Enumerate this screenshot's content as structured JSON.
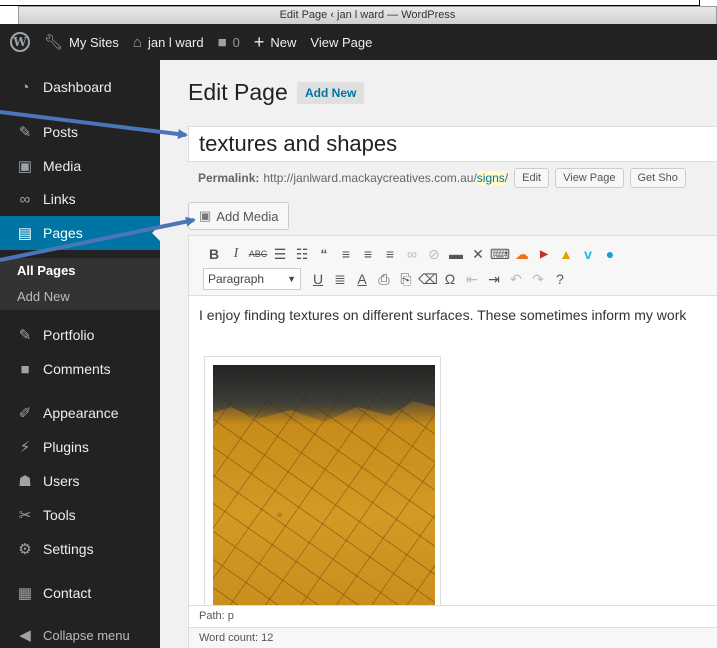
{
  "window": {
    "title": "Edit Page ‹ jan l ward — WordPress"
  },
  "adminbar": {
    "my_sites": "My Sites",
    "site_name": "jan l ward",
    "comments_count": "0",
    "new_label": "New",
    "view_page": "View Page",
    "icons": [
      "wordpress-logo",
      "wrench",
      "home",
      "comment-bubble",
      "plus"
    ]
  },
  "sidebar": {
    "items": [
      {
        "label": "Dashboard",
        "icon": "dashboard-icon"
      },
      {
        "label": "Posts",
        "icon": "pin-icon"
      },
      {
        "label": "Media",
        "icon": "media-icon"
      },
      {
        "label": "Links",
        "icon": "link-icon"
      },
      {
        "label": "Pages",
        "icon": "pages-icon",
        "active": true
      },
      {
        "label": "Portfolio",
        "icon": "pin-icon"
      },
      {
        "label": "Comments",
        "icon": "comment-icon"
      },
      {
        "label": "Appearance",
        "icon": "brush-icon"
      },
      {
        "label": "Plugins",
        "icon": "plug-icon"
      },
      {
        "label": "Users",
        "icon": "user-icon"
      },
      {
        "label": "Tools",
        "icon": "wrench-icon"
      },
      {
        "label": "Settings",
        "icon": "settings-icon"
      },
      {
        "label": "Contact",
        "icon": "form-icon"
      },
      {
        "label": "Collapse menu",
        "icon": "collapse-icon"
      }
    ],
    "pages_sub": [
      "All Pages",
      "Add New"
    ]
  },
  "main": {
    "heading": "Edit Page",
    "add_new": "Add New",
    "title_value": "textures and shapes",
    "permalink_label": "Permalink:",
    "permalink_base": "http://janlward.mackaycreatives.com.au/",
    "permalink_slug": "signs",
    "permalink_trail": "/",
    "edit_btn": "Edit",
    "view_page_btn": "View Page",
    "get_shortlink_btn": "Get Sho",
    "add_media": "Add Media",
    "format_select": "Paragraph",
    "content": "I enjoy finding textures on different surfaces. These sometimes inform my work",
    "path": "Path: p",
    "word_count": "Word count: 12"
  },
  "colors": {
    "adminbar": "#222222",
    "sidebar": "#222222",
    "active_menu": "#0074a2",
    "page_bg": "#f1f1f1",
    "annotation_arrow": "#4a76b8"
  }
}
